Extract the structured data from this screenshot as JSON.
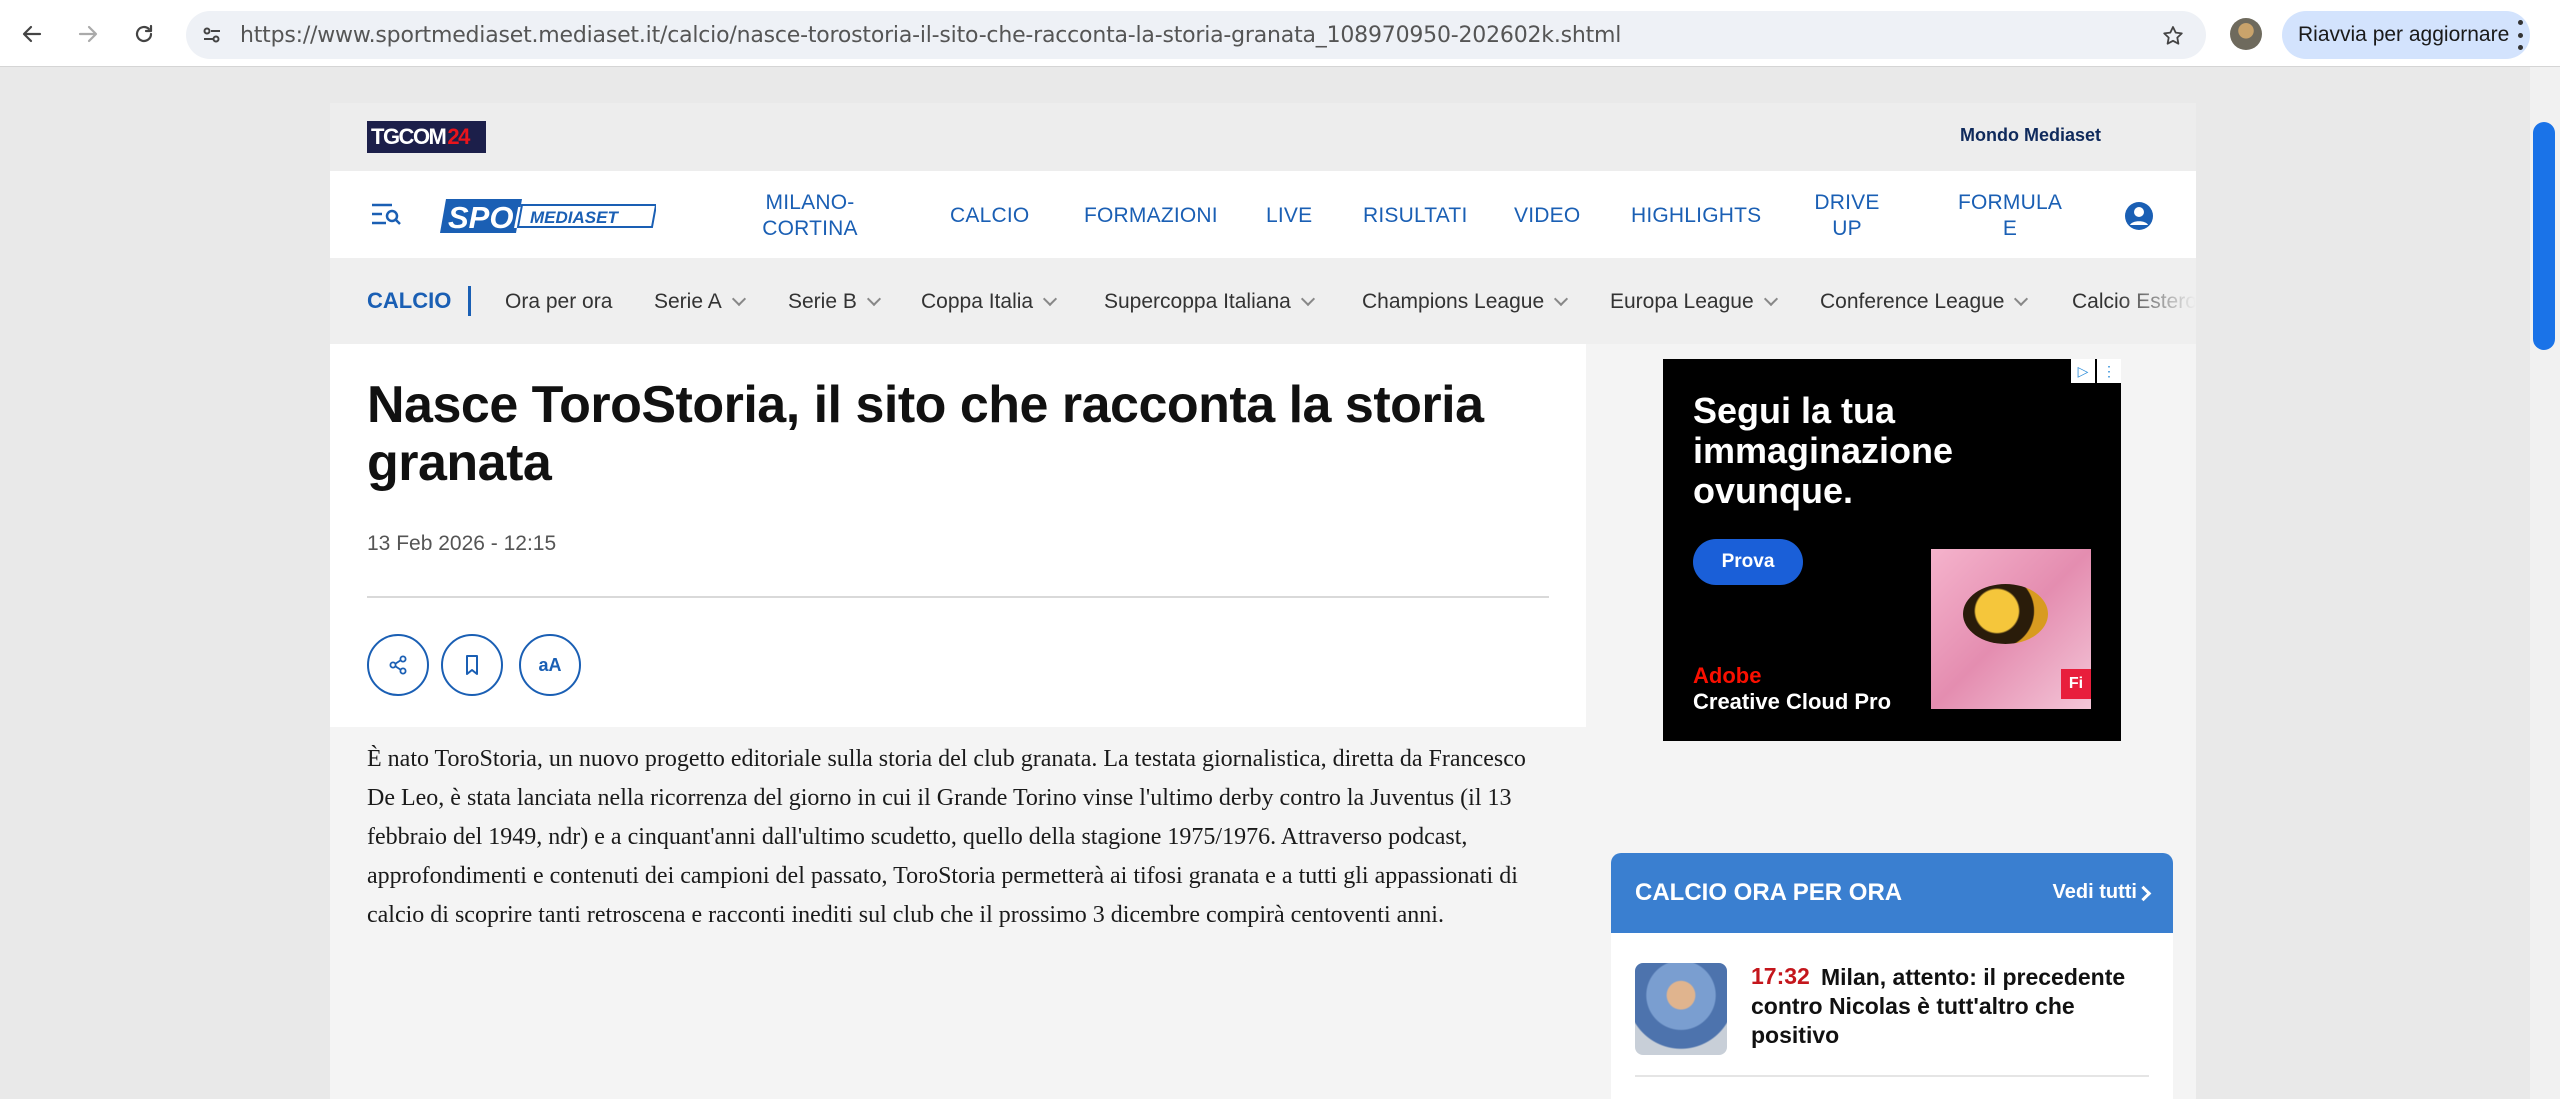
{
  "browser": {
    "url": "https://www.sportmediaset.mediaset.it/calcio/nasce-torostoria-il-sito-che-racconta-la-storia-granata_108970950-202602k.shtml",
    "update_label": "Riavvia per aggiornare"
  },
  "header": {
    "tgcom_logo": {
      "text": "TGCOM",
      "number": "24"
    },
    "mondo_link": "Mondo Mediaset",
    "logo": {
      "sport": "SPORT",
      "mediaset": "MEDIASET"
    },
    "nav": [
      {
        "label": "MILANO-\nCORTINA"
      },
      {
        "label": "CALCIO"
      },
      {
        "label": "FORMAZIONI"
      },
      {
        "label": "LIVE"
      },
      {
        "label": "RISULTATI"
      },
      {
        "label": "VIDEO"
      },
      {
        "label": "HIGHLIGHTS"
      },
      {
        "label": "DRIVE\nUP"
      },
      {
        "label": "FORMULA\nE"
      }
    ]
  },
  "subnav": {
    "section": "CALCIO",
    "items": [
      {
        "label": "Ora per ora",
        "dropdown": false
      },
      {
        "label": "Serie A",
        "dropdown": true
      },
      {
        "label": "Serie B",
        "dropdown": true
      },
      {
        "label": "Coppa Italia",
        "dropdown": true
      },
      {
        "label": "Supercoppa Italiana",
        "dropdown": true
      },
      {
        "label": "Champions League",
        "dropdown": true
      },
      {
        "label": "Europa League",
        "dropdown": true
      },
      {
        "label": "Conference League",
        "dropdown": true
      },
      {
        "label": "Calcio Estero",
        "dropdown": false
      }
    ]
  },
  "article": {
    "title": "Nasce ToroStoria, il sito che racconta la storia granata",
    "date": "13 Feb 2026 - 12:15",
    "text_size_label": "aA",
    "body": "È nato ToroStoria, un nuovo progetto editoriale sulla storia del club granata. La testata giornalistica, diretta da Francesco De Leo, è stata lanciata nella ricorrenza del giorno in cui il Grande Torino vinse l'ultimo derby contro la Juventus (il 13 febbraio del 1949, ndr) e a cinquant'anni dall'ultimo scudetto, quello della stagione 1975/1976. Attraverso podcast, approfondimenti e contenuti dei campioni del passato, ToroStoria permetterà ai tifosi granata e a tutti gli appassionati di calcio di scoprire tanti retroscena e racconti inediti sul club che il prossimo 3 dicembre compirà centoventi anni."
  },
  "ad": {
    "headline": "Segui la tua immaginazione ovunque.",
    "cta": "Prova",
    "brand": "Adobe",
    "product": "Creative Cloud Pro",
    "badge": "Fi"
  },
  "widget": {
    "title": "CALCIO ORA PER ORA",
    "see_all": "Vedi tutti",
    "items": [
      {
        "time": "17:32",
        "text": "Milan, attento: il precedente contro Nicolas è tutt'altro che positivo"
      }
    ]
  },
  "colors": {
    "brand_blue": "#1a5fb4",
    "widget_blue": "#3a7fd0",
    "time_red": "#c4161c",
    "tgcom_navy": "#1c1f4a"
  }
}
